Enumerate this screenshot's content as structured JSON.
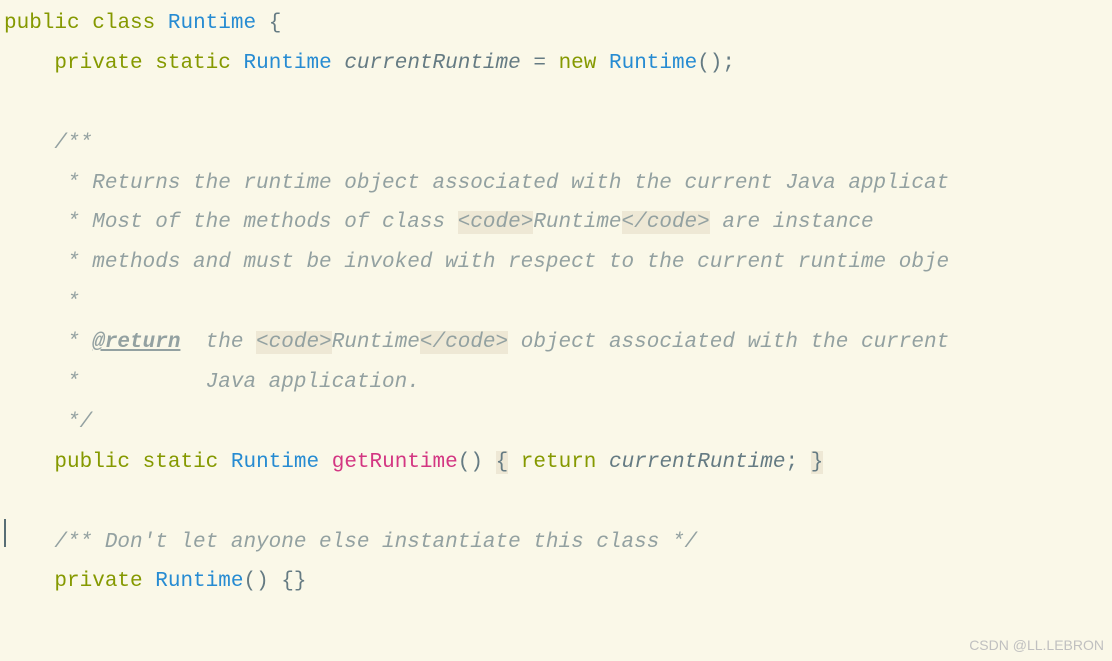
{
  "code": {
    "l1_public": "public",
    "l1_class": "class",
    "l1_Runtime": "Runtime",
    "l1_brace": "{",
    "l2_private": "private",
    "l2_static": "static",
    "l2_type": "Runtime",
    "l2_var": "currentRuntime",
    "l2_eq": " = ",
    "l2_new": "new",
    "l2_ctor": "Runtime",
    "l2_paren": "()",
    "l2_semi": ";",
    "l4_open": "    /**",
    "l5": "     * Returns the runtime object associated with the current Java applicat",
    "l6a": "     * Most of the methods of class ",
    "l6_code_open": "<code>",
    "l6_runtime": "Runtime",
    "l6_code_close": "</code>",
    "l6b": " are instance",
    "l7": "     * methods and must be invoked with respect to the current runtime obje",
    "l8": "     *",
    "l9a": "     * ",
    "l9_tag": "@return",
    "l9b": "  the ",
    "l9_code_open": "<code>",
    "l9_runtime": "Runtime",
    "l9_code_close": "</code>",
    "l9c": " object associated with the current",
    "l10": "     *          Java application.",
    "l11_close": "     */",
    "l12_public": "public",
    "l12_static": "static",
    "l12_type": "Runtime",
    "l12_method": "getRuntime",
    "l12_paren": "()",
    "l12_brace_open": "{",
    "l12_return": "return",
    "l12_var": "currentRuntime",
    "l12_semi": ";",
    "l12_brace_close": "}",
    "l14": "    /** Don't let anyone else instantiate this class */",
    "l15_private": "private",
    "l15_ctor": "Runtime",
    "l15_paren": "()",
    "l15_braces": "{}"
  },
  "watermark": "CSDN @LL.LEBRON"
}
